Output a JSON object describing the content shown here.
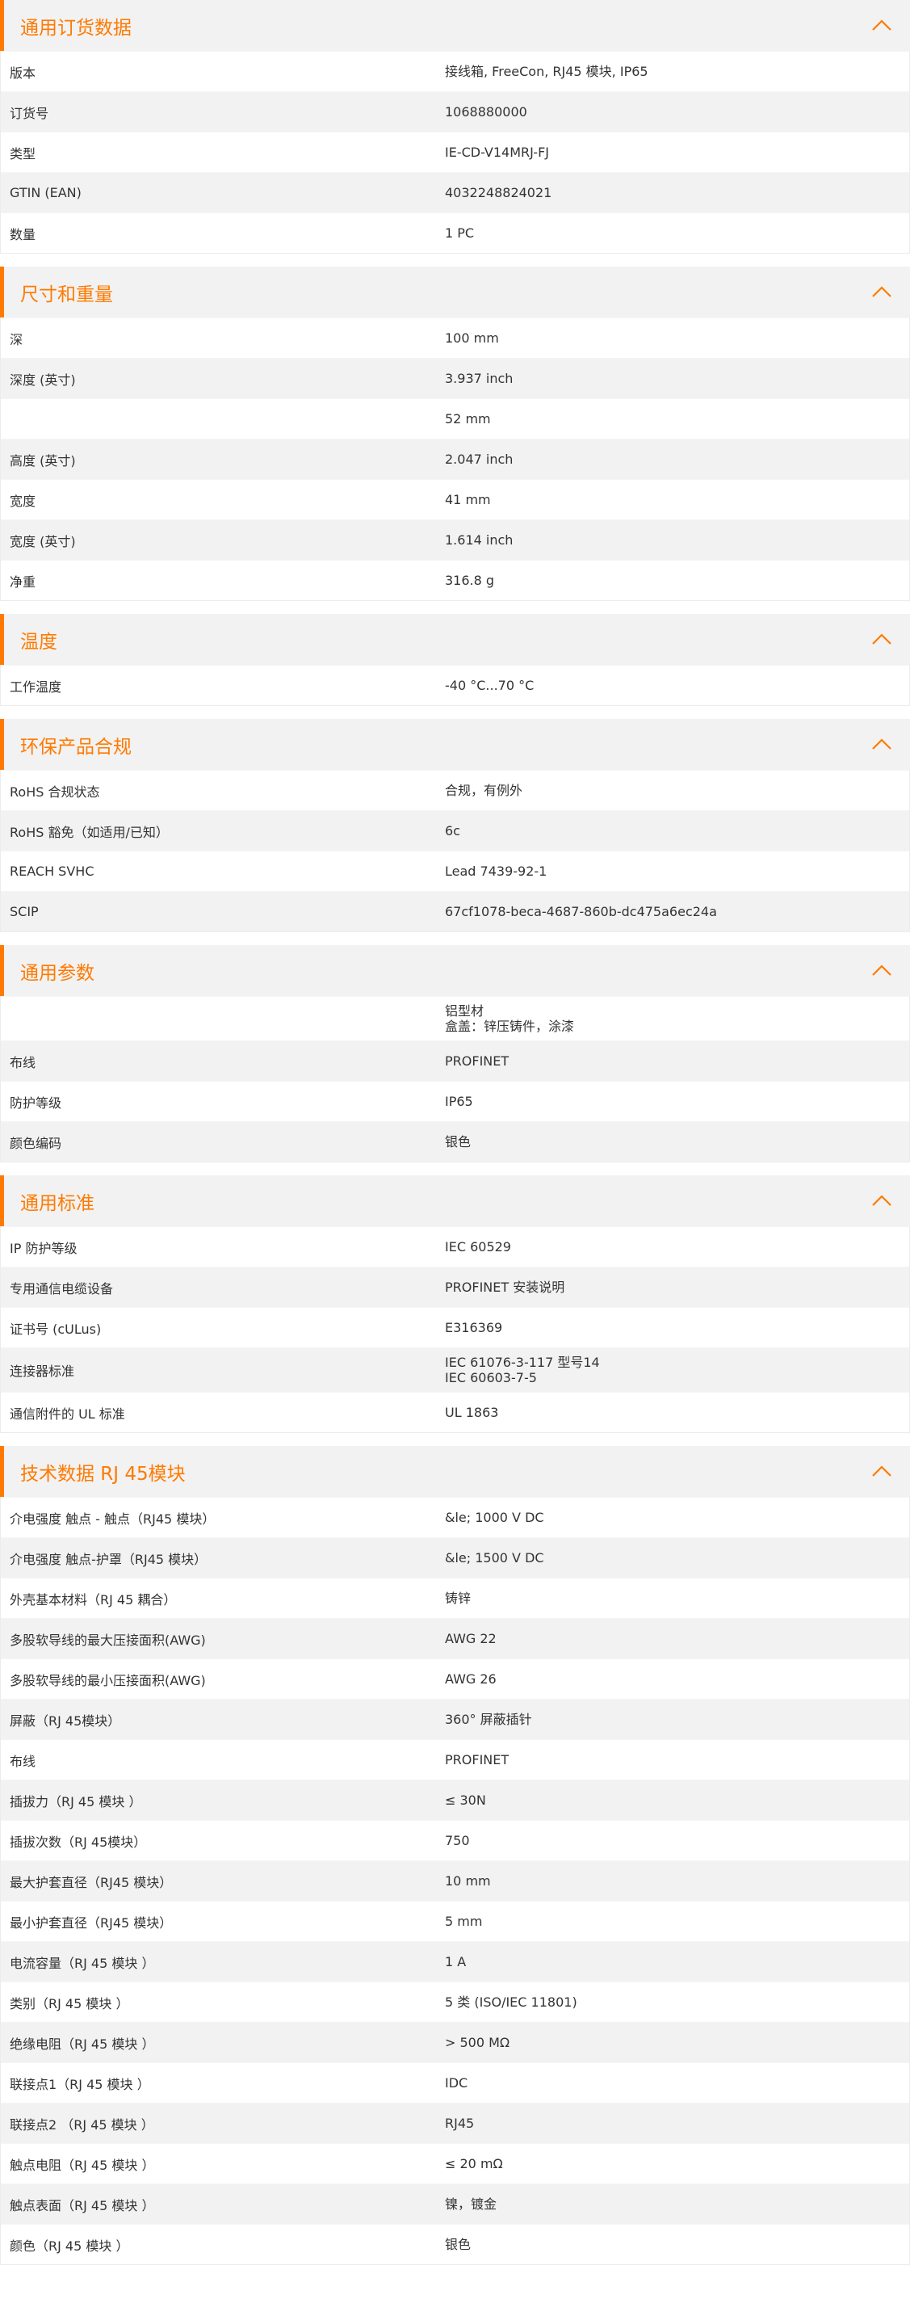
{
  "accent_color": "#ff7a00",
  "sections": [
    {
      "title": "通用订货数据",
      "rows": [
        {
          "label": "版本",
          "value": "接线箱, FreeCon, RJ45 模块, IP65"
        },
        {
          "label": "订货号",
          "value": "1068880000"
        },
        {
          "label": "类型",
          "value": "IE-CD-V14MRJ-FJ"
        },
        {
          "label": "GTIN (EAN)",
          "value": "4032248824021"
        },
        {
          "label": "数量",
          "value": "1  PC"
        }
      ]
    },
    {
      "title": "尺寸和重量",
      "rows": [
        {
          "label": "深",
          "value": "100  mm"
        },
        {
          "label": "深度 (英寸)",
          "value": "3.937  inch"
        },
        {
          "label": "",
          "value": "52  mm"
        },
        {
          "label": "高度 (英寸)",
          "value": "2.047  inch"
        },
        {
          "label": "宽度",
          "value": "41  mm"
        },
        {
          "label": "宽度 (英寸)",
          "value": "1.614  inch"
        },
        {
          "label": "净重",
          "value": "316.8  g"
        }
      ]
    },
    {
      "title": "温度",
      "rows": [
        {
          "label": "工作温度",
          "value": "-40 °C...70 °C"
        }
      ]
    },
    {
      "title": "环保产品合规",
      "rows": [
        {
          "label": "RoHS 合规状态",
          "value": "合规，有例外"
        },
        {
          "label": "RoHS 豁免（如适用/已知）",
          "value": "6c"
        },
        {
          "label": "REACH SVHC",
          "value": "Lead 7439-92-1"
        },
        {
          "label": "SCIP",
          "value": "67cf1078-beca-4687-860b-dc475a6ec24a"
        }
      ]
    },
    {
      "title": "通用参数",
      "rows": [
        {
          "label": "",
          "value": "铝型材\n盒盖：锌压铸件，涂漆"
        },
        {
          "label": "布线",
          "value": "PROFINET"
        },
        {
          "label": "防护等级",
          "value": "IP65"
        },
        {
          "label": "颜色编码",
          "value": "银色"
        }
      ]
    },
    {
      "title": "通用标准",
      "rows": [
        {
          "label": "IP 防护等级",
          "value": "IEC 60529"
        },
        {
          "label": "专用通信电缆设备",
          "value": "PROFINET 安装说明"
        },
        {
          "label": "证书号 (cULus)",
          "value": "E316369"
        },
        {
          "label": "连接器标准",
          "value": "IEC 61076-3-117 型号14\nIEC 60603-7-5"
        },
        {
          "label": "通信附件的 UL 标准",
          "value": "UL 1863"
        }
      ]
    },
    {
      "title": "技术数据 RJ 45模块",
      "rows": [
        {
          "label": "介电强度 触点 - 触点（RJ45 模块）",
          "value": "&le; 1000 V DC"
        },
        {
          "label": "介电强度 触点-护罩（RJ45 模块）",
          "value": "&le; 1500 V DC"
        },
        {
          "label": "外壳基本材料（RJ 45 耦合）",
          "value": "铸锌"
        },
        {
          "label": "多股软导线的最大压接面积(AWG)",
          "value": "AWG 22"
        },
        {
          "label": "多股软导线的最小压接面积(AWG)",
          "value": "AWG 26"
        },
        {
          "label": "屏蔽（RJ 45模块）",
          "value": "360° 屏蔽插针"
        },
        {
          "label": "布线",
          "value": "PROFINET"
        },
        {
          "label": "插拔力（RJ 45 模块 ）",
          "value": "≤ 30N"
        },
        {
          "label": "插拔次数（RJ 45模块）",
          "value": "750"
        },
        {
          "label": "最大护套直径（RJ45 模块）",
          "value": "10  mm"
        },
        {
          "label": "最小护套直径（RJ45 模块）",
          "value": "5  mm"
        },
        {
          "label": "电流容量（RJ 45 模块 ）",
          "value": "1 A"
        },
        {
          "label": "类别（RJ 45 模块 ）",
          "value": "5 类 (ISO/IEC 11801)"
        },
        {
          "label": "绝缘电阻（RJ 45 模块 ）",
          "value": "> 500 MΩ"
        },
        {
          "label": "联接点1（RJ 45 模块 ）",
          "value": "IDC"
        },
        {
          "label": "联接点2 （RJ 45 模块 ）",
          "value": "RJ45"
        },
        {
          "label": "触点电阻（RJ 45 模块 ）",
          "value": "≤ 20 mΩ"
        },
        {
          "label": "触点表面（RJ 45 模块 ）",
          "value": "镍，镀金"
        },
        {
          "label": "颜色（RJ 45 模块 ）",
          "value": "银色"
        }
      ]
    }
  ]
}
